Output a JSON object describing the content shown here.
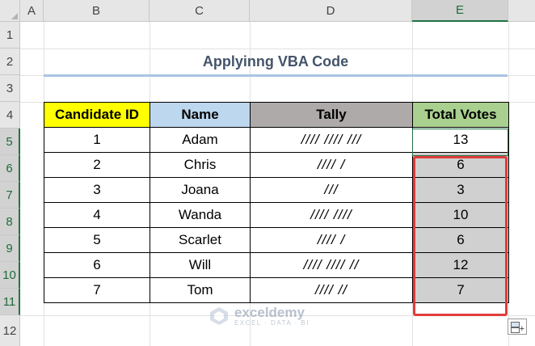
{
  "columns": [
    "A",
    "B",
    "C",
    "D",
    "E"
  ],
  "rows": [
    "1",
    "2",
    "3",
    "4",
    "5",
    "6",
    "7",
    "8",
    "9",
    "10",
    "11",
    "12"
  ],
  "title": "Applyinng VBA Code",
  "table": {
    "headers": [
      "Candidate ID",
      "Name",
      "Tally",
      "Total Votes"
    ],
    "rows": [
      {
        "id": "1",
        "name": "Adam",
        "tally": "//// //// ///",
        "total": "13"
      },
      {
        "id": "2",
        "name": "Chris",
        "tally": "//// /",
        "total": "6"
      },
      {
        "id": "3",
        "name": "Joana",
        "tally": "///",
        "total": "3"
      },
      {
        "id": "4",
        "name": "Wanda",
        "tally": "//// ////",
        "total": "10"
      },
      {
        "id": "5",
        "name": "Scarlet",
        "tally": "//// /",
        "total": "6"
      },
      {
        "id": "6",
        "name": "Will",
        "tally": "//// //// //",
        "total": "12"
      },
      {
        "id": "7",
        "name": "Tom",
        "tally": "//// //",
        "total": "7"
      }
    ]
  },
  "watermark": {
    "name": "exceldemy",
    "tagline": "EXCEL · DATA · BI"
  },
  "colors": {
    "header_id": "#ffff00",
    "header_name": "#bdd7ee",
    "header_tally": "#aeaaaa",
    "header_total": "#a9d08e",
    "selection_outline": "#e03c3c",
    "excel_green": "#217346"
  },
  "icons": [
    "quick-analysis-icon",
    "exceldemy-logo-icon"
  ]
}
